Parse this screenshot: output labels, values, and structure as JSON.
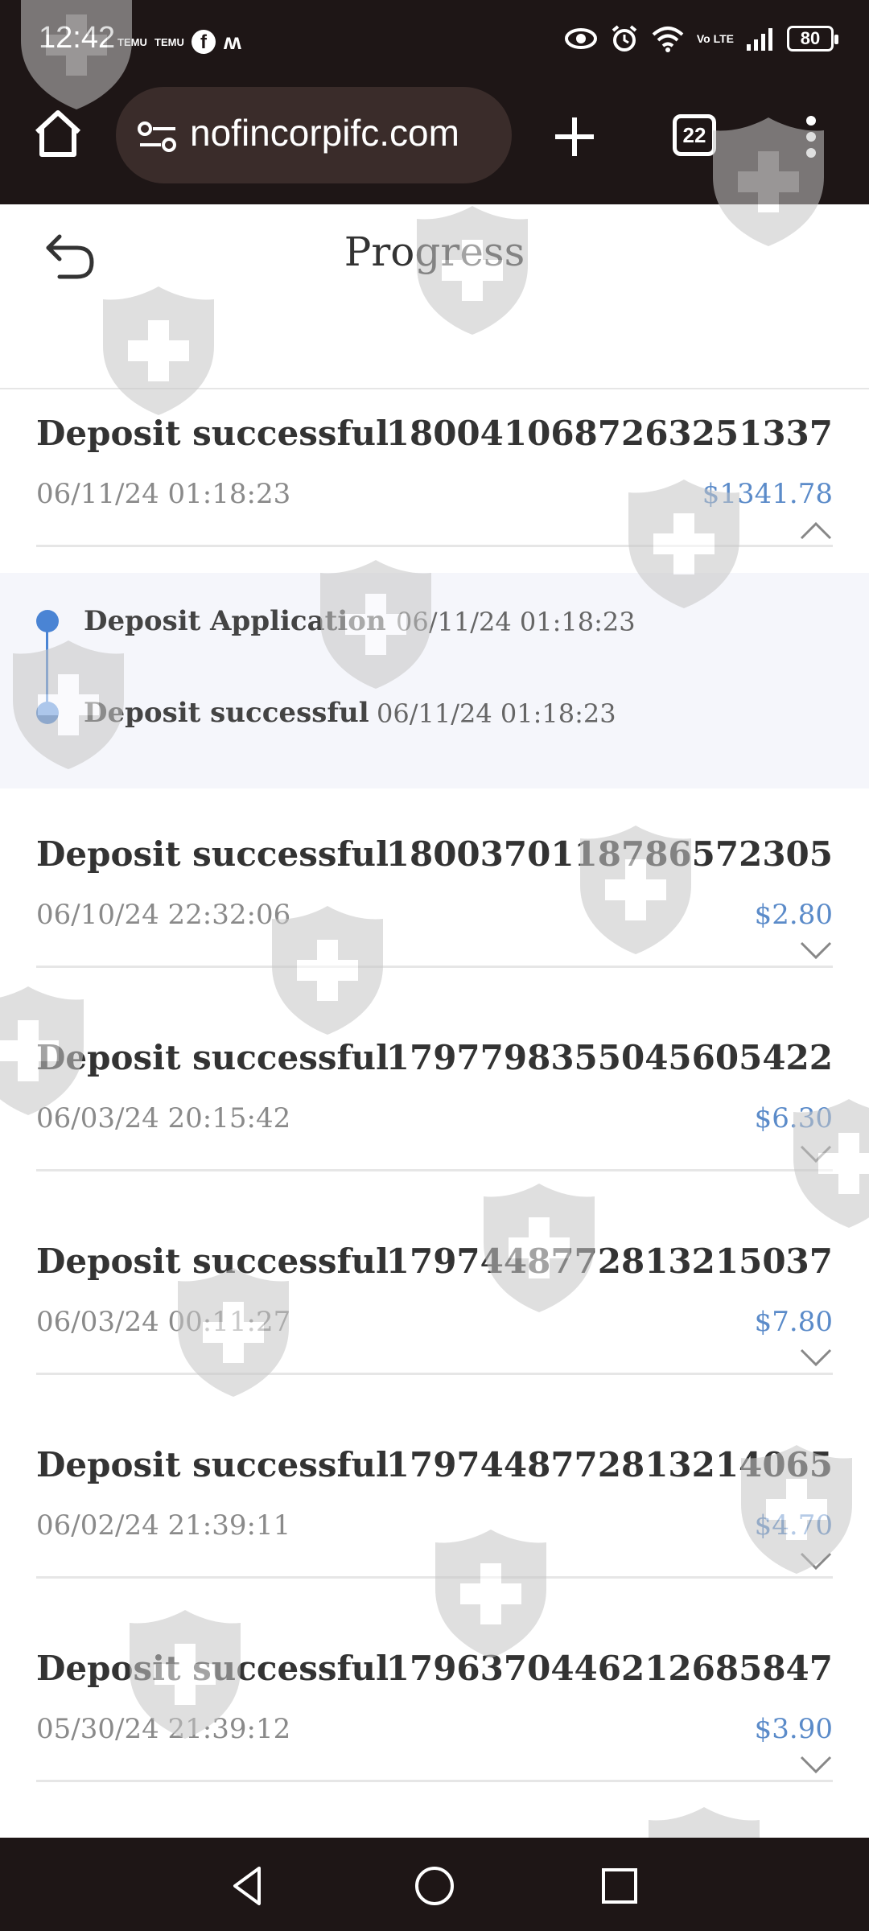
{
  "status_bar": {
    "time": "12:42",
    "left_icons": [
      "temu-icon",
      "temu-icon",
      "facebook-icon",
      "messenger-icon"
    ],
    "mini_label": "TEMU",
    "vo_lte": "Vo LTE",
    "battery": "80"
  },
  "browser": {
    "url": "nofincorpifc.com",
    "tab_count": "22"
  },
  "page": {
    "title": "Progress"
  },
  "records": [
    {
      "title": "Deposit successful",
      "id": "1800410687263251337",
      "date": "06/11/24 01:18:23",
      "amount": "$1341.78",
      "expanded": true
    },
    {
      "title": "Deposit successful",
      "id": "1800370118786572305",
      "date": "06/10/24 22:32:06",
      "amount": "$2.80",
      "expanded": false
    },
    {
      "title": "Deposit successful",
      "id": "1797798355045605422",
      "date": "06/03/24 20:15:42",
      "amount": "$6.30",
      "expanded": false
    },
    {
      "title": "Deposit successful",
      "id": "1797448772813215037",
      "date": "06/03/24 00:11:27",
      "amount": "$7.80",
      "expanded": false
    },
    {
      "title": "Deposit successful",
      "id": "1797448772813214065",
      "date": "06/02/24 21:39:11",
      "amount": "$4.70",
      "expanded": false
    },
    {
      "title": "Deposit successful",
      "id": "1796370446212685847",
      "date": "05/30/24 21:39:12",
      "amount": "$3.90",
      "expanded": false
    }
  ],
  "timeline": [
    {
      "label": "Deposit Application",
      "time": "06/11/24 01:18:23"
    },
    {
      "label": "Deposit successful",
      "time": "06/11/24 01:18:23"
    }
  ],
  "colors": {
    "bar_bg": "#1e1616",
    "amount": "#5b8bc9",
    "timeline_accent": "#4a84d4"
  }
}
